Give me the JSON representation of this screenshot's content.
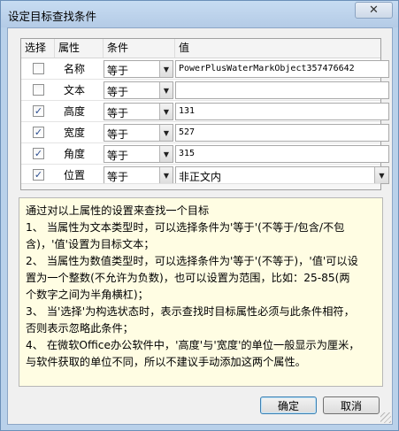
{
  "window": {
    "title": "设定目标查找条件",
    "close_symbol": "✕"
  },
  "grid": {
    "columns": [
      "选择",
      "属性",
      "条件",
      "值"
    ],
    "rows": [
      {
        "checked": false,
        "name": "名称",
        "condition": "等于",
        "value": "PowerPlusWaterMarkObject357476642",
        "value_type": "text"
      },
      {
        "checked": false,
        "name": "文本",
        "condition": "等于",
        "value": "",
        "value_type": "text"
      },
      {
        "checked": true,
        "name": "高度",
        "condition": "等于",
        "value": "131",
        "value_type": "text"
      },
      {
        "checked": true,
        "name": "宽度",
        "condition": "等于",
        "value": "527",
        "value_type": "text"
      },
      {
        "checked": true,
        "name": "角度",
        "condition": "等于",
        "value": "315",
        "value_type": "text"
      },
      {
        "checked": true,
        "name": "位置",
        "condition": "等于",
        "value": "非正文内",
        "value_type": "select"
      }
    ],
    "check_mark": "✓",
    "dropdown_icon": "▼"
  },
  "info": {
    "lines": [
      "通过对以上属性的设置来查找一个目标",
      "1、 当属性为文本类型时，可以选择条件为'等于'(不等于/包含/不包",
      "含)，'值'设置为目标文本；",
      "2、 当属性为数值类型时，可以选择条件为'等于'(不等于)，'值'可以设",
      "置为一个整数(不允许为负数)，也可以设置为范围，比如：25-85(两",
      "个数字之间为半角横杠)；",
      "3、 当'选择'为构选状态时，表示查找时目标属性必须与此条件相符，",
      "否则表示忽略此条件；",
      "4、 在微软Office办公软件中，'高度'与'宽度'的单位一般显示为厘米，",
      "与软件获取的单位不同，所以不建议手动添加这两个属性。"
    ]
  },
  "buttons": {
    "ok": "确定",
    "cancel": "取消"
  }
}
